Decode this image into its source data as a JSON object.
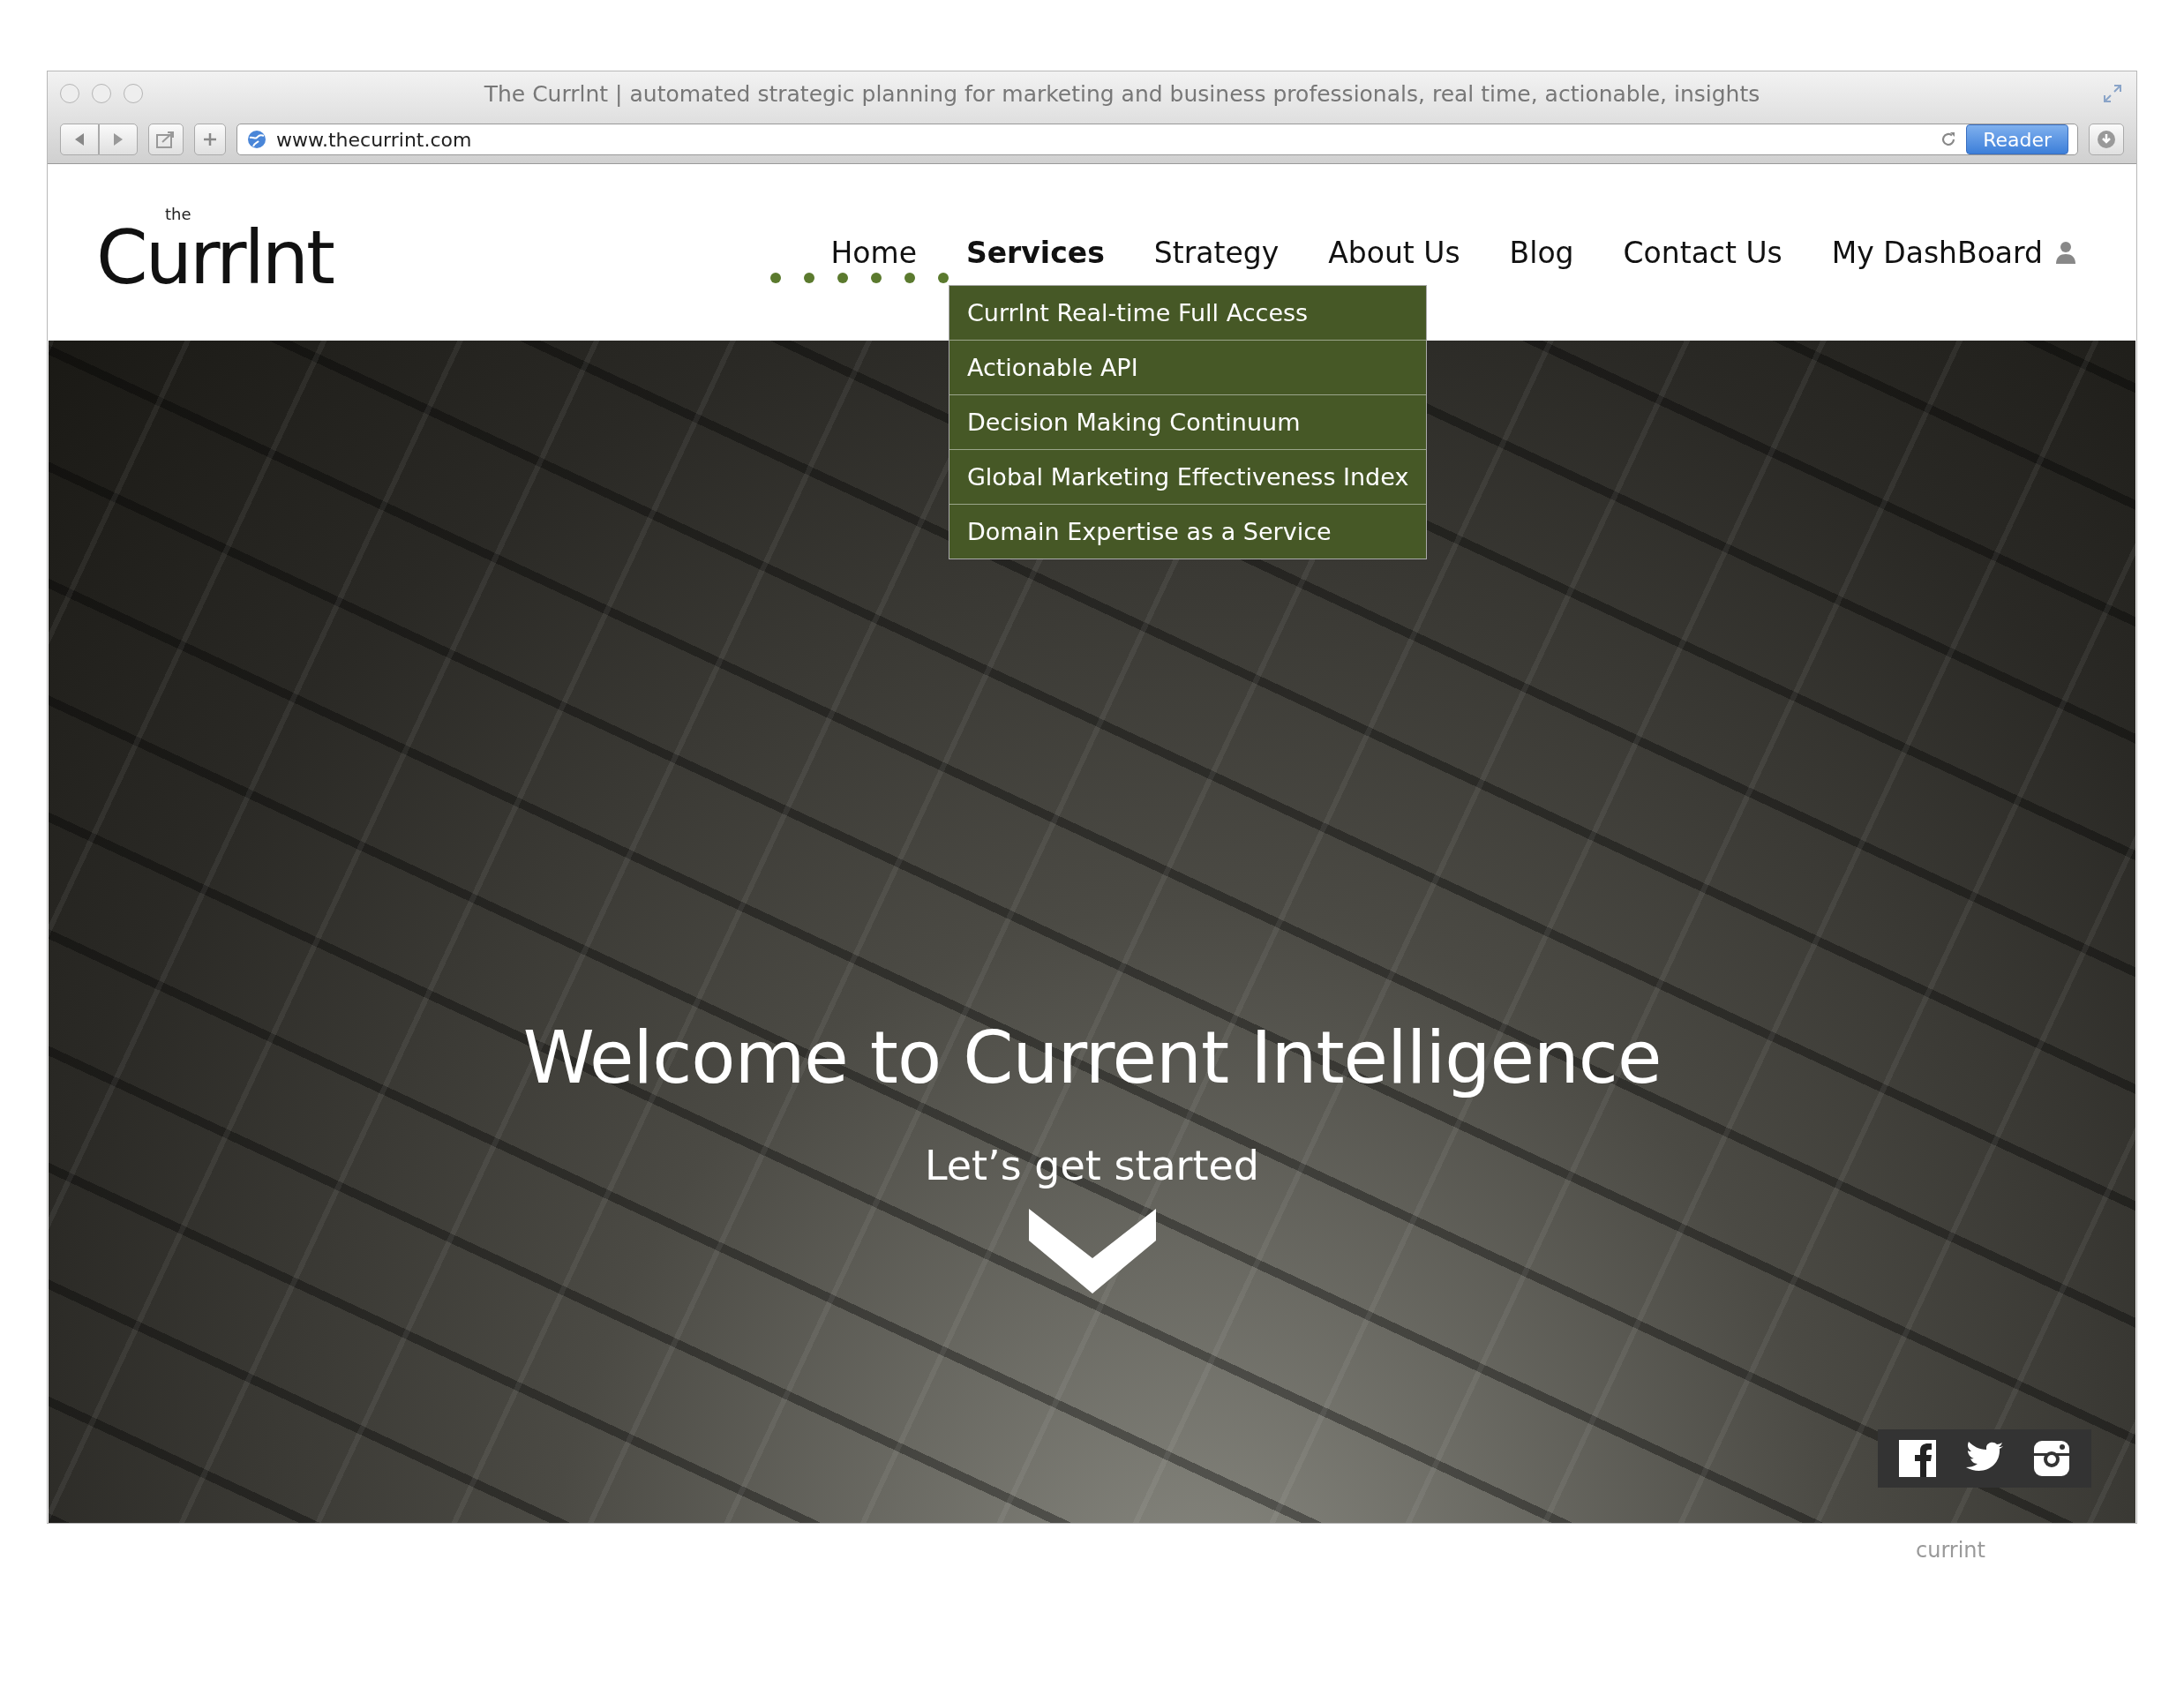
{
  "browser": {
    "title": "The Currlnt | automated strategic planning for marketing and business professionals, real time, actionable, insights",
    "url": "www.thecurrint.com",
    "reader_button": "Reader"
  },
  "logo": {
    "small": "the",
    "text": "Currlnt"
  },
  "nav": [
    {
      "label": "Home",
      "selected": false
    },
    {
      "label": "Services",
      "selected": true,
      "expanded": true,
      "children": [
        "Currlnt Real-time Full Access",
        "Actionable API",
        "Decision Making Continuum",
        "Global Marketing Effectiveness Index",
        "Domain Expertise as a Service"
      ]
    },
    {
      "label": "Strategy",
      "selected": false
    },
    {
      "label": "About Us",
      "selected": false
    },
    {
      "label": "Blog",
      "selected": false
    },
    {
      "label": "Contact Us",
      "selected": false
    },
    {
      "label": "My DashBoard",
      "selected": false,
      "kind": "user"
    }
  ],
  "hero": {
    "title": "Welcome to Current Intelligence",
    "subtitle": "Let’s get started"
  },
  "footer": {
    "text": "currint"
  }
}
